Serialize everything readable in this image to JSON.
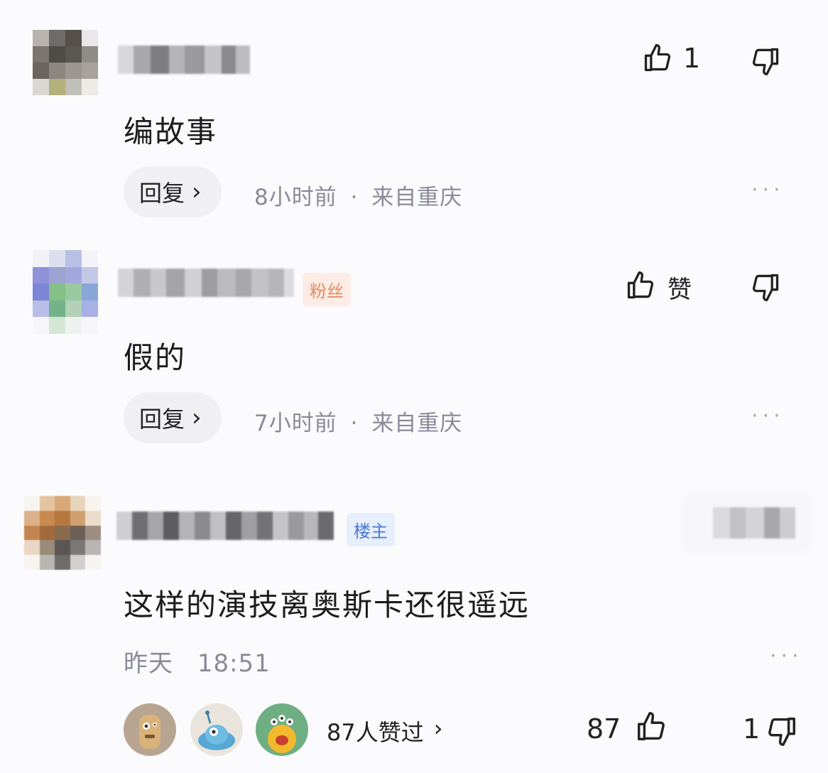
{
  "comments": [
    {
      "text": "编故事",
      "reply_label": "回复",
      "time": "8小时前",
      "location": "来自重庆",
      "like_count": "1",
      "icons": {
        "like": "thumbs-up-icon",
        "dislike": "thumbs-down-icon",
        "more": "more-dots-icon"
      }
    },
    {
      "badge": "粉丝",
      "text": "假的",
      "reply_label": "回复",
      "time": "7小时前",
      "location": "来自重庆",
      "like_label": "赞",
      "icons": {
        "like": "thumbs-up-icon",
        "dislike": "thumbs-down-icon",
        "more": "more-dots-icon"
      }
    },
    {
      "badge": "楼主",
      "text": "这样的演技离奥斯卡还很遥远",
      "date": "昨天",
      "time": "18:51",
      "likers_label": "87人赞过",
      "like_count": "87",
      "dislike_count": "1",
      "icons": {
        "like": "thumbs-up-icon",
        "dislike": "thumbs-down-icon",
        "more": "more-dots-icon"
      }
    }
  ],
  "separator": "·",
  "more_glyph": "···",
  "chevron": "›",
  "colors": {
    "fan_badge": "#e88a5a",
    "host_badge": "#4a78d6",
    "meta_text": "#8a8a9a"
  }
}
